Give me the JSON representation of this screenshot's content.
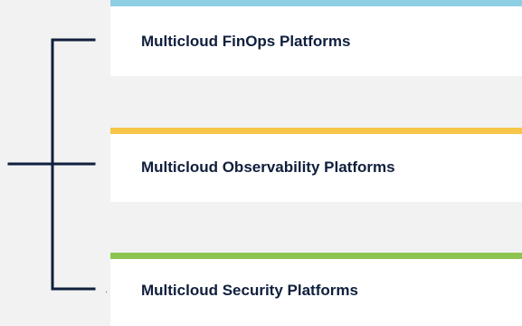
{
  "cards": [
    {
      "label": "Multicloud FinOps Platforms",
      "accent_color": "#8fcfe3"
    },
    {
      "label": "Multicloud Observability Platforms",
      "accent_color": "#f7c548"
    },
    {
      "label": "Multicloud Security Platforms",
      "accent_color": "#8dc44f"
    }
  ],
  "connector": {
    "color": "#0f1f3d"
  },
  "stray_mark": "."
}
